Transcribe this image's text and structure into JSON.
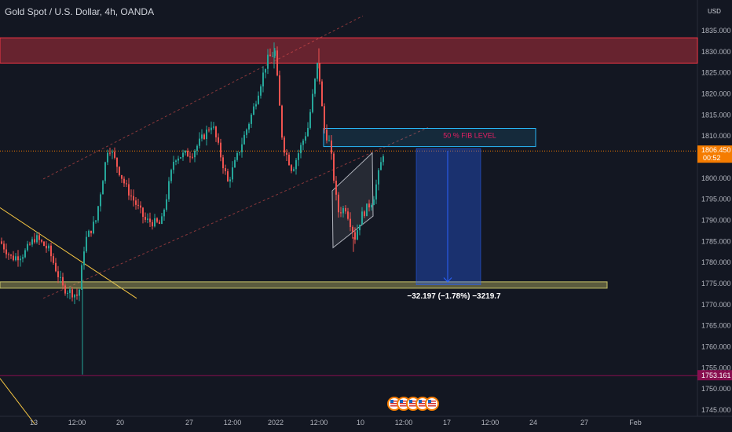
{
  "header": {
    "symbol_title": "Gold Spot / U.S. Dollar, 4h, OANDA",
    "currency": "USD"
  },
  "price_axis": {
    "ticks": [
      "1835.000",
      "1830.000",
      "1825.000",
      "1820.000",
      "1815.000",
      "1810.000",
      "1800.000",
      "1795.000",
      "1790.000",
      "1785.000",
      "1780.000",
      "1775.000",
      "1770.000",
      "1765.000",
      "1760.000",
      "1755.000",
      "1750.000",
      "1745.000"
    ],
    "current_price": "1806.450",
    "countdown": "00:52",
    "low_marker": "1753.161"
  },
  "time_axis": {
    "ticks": [
      "13",
      "12:00",
      "20",
      "27",
      "12:00",
      "2022",
      "12:00",
      "10",
      "12:00",
      "17",
      "12:00",
      "24",
      "27",
      "Feb"
    ]
  },
  "annotations": {
    "fib_label": "50 % FIB LEVEL",
    "measure_label": "−32.197 (−1.78%) −3219.7"
  },
  "colors": {
    "background": "#131722",
    "up": "#26a69a",
    "down": "#ef5350",
    "resistance_zone": "#f23645",
    "support_zone": "#c9c46a",
    "fib_box": "#29b6f6",
    "short_position": "#2962ff",
    "price_badge": "#f57c00",
    "low_badge": "#880e4f"
  },
  "events": {
    "icons": [
      "us-flag-icon",
      "us-flag-icon",
      "us-flag-icon",
      "us-flag-icon",
      "us-flag-icon"
    ]
  }
}
